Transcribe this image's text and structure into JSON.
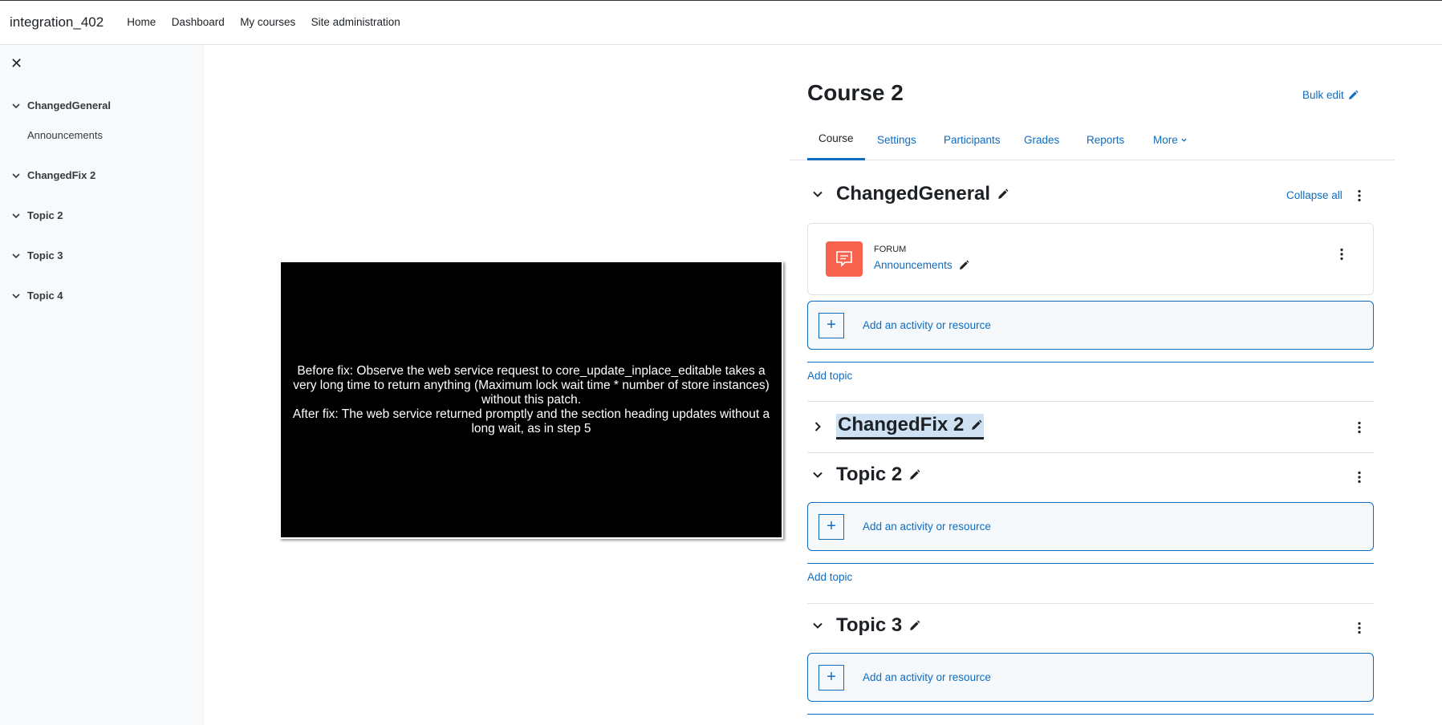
{
  "header": {
    "site_name": "integration_402",
    "nav": [
      "Home",
      "Dashboard",
      "My courses",
      "Site administration"
    ]
  },
  "drawer": {
    "close_glyph": "✕",
    "sections": [
      {
        "label": "ChangedGeneral",
        "items": [
          "Announcements"
        ]
      },
      {
        "label": "ChangedFix 2"
      },
      {
        "label": "Topic 2"
      },
      {
        "label": "Topic 3"
      },
      {
        "label": "Topic 4"
      }
    ]
  },
  "video": {
    "line1": "Before fix: Observe the web service request to core_update_inplace_editable takes a very long time to return anything (Maximum lock wait time * number of store instances) without this patch.",
    "line2": "After fix: The web service returned promptly and the section heading updates without a long wait, as in step 5"
  },
  "course": {
    "title": "Course 2",
    "bulk_edit": "Bulk edit",
    "tabs": [
      "Course",
      "Settings",
      "Participants",
      "Grades",
      "Reports",
      "More"
    ],
    "collapse_all": "Collapse all",
    "sections": [
      {
        "title": "ChangedGeneral",
        "expanded": true
      },
      {
        "title": "ChangedFix 2",
        "expanded": false,
        "highlighted": true
      },
      {
        "title": "Topic 2",
        "expanded": true
      },
      {
        "title": "Topic 3",
        "expanded": true
      }
    ],
    "activity": {
      "type": "FORUM",
      "name": "Announcements"
    },
    "add_activity": "Add an activity or resource",
    "add_topic": "Add topic"
  },
  "colors": {
    "link": "#0f6cbf",
    "forum_icon_bg": "#f7634d",
    "drawer_bg": "#f8f9fa",
    "highlight_bg": "#cfe2f3"
  }
}
